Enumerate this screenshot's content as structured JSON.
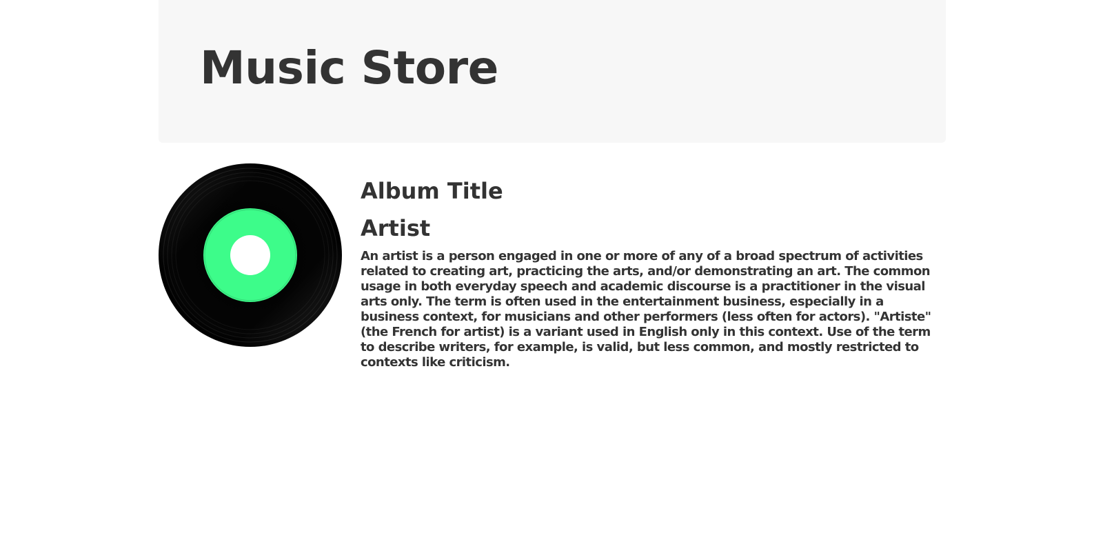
{
  "header": {
    "title": "Music Store"
  },
  "album": {
    "title": "Album Title",
    "artist": "Artist",
    "description": "An artist is a person engaged in one or more of any of a broad spectrum of activities related to creating art, practicing the arts, and/or demonstrating an art. The common usage in both everyday speech and academic discourse is a practitioner in the visual arts only. The term is often used in the entertainment business, especially in a business context, for musicians and other performers (less often for actors). \"Artiste\" (the French for artist) is a variant used in English only in this context. Use of the term to describe writers, for example, is valid, but less common, and mostly restricted to contexts like criticism.",
    "cover_icon": "vinyl-record-icon"
  },
  "colors": {
    "header_bg": "#f7f7f7",
    "text": "#333333",
    "record_black": "#000000",
    "record_label": "#3dfc8a"
  }
}
